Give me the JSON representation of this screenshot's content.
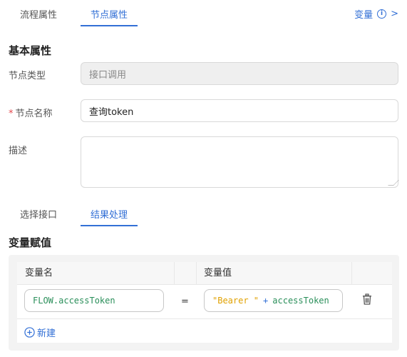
{
  "tabs": {
    "process_properties": "流程属性",
    "node_properties": "节点属性"
  },
  "header": {
    "variables_link": "变量",
    "info_icon": "info-icon",
    "chevron": ">"
  },
  "basic": {
    "title": "基本属性",
    "node_type_label": "节点类型",
    "node_type_value": "接口调用",
    "node_name_label": "节点名称",
    "node_name_value": "查询token",
    "description_label": "描述",
    "description_value": ""
  },
  "subtabs": {
    "select_interface": "选择接口",
    "result_handling": "结果处理"
  },
  "assignment": {
    "title": "变量赋值",
    "columns": [
      "变量名",
      "变量值"
    ],
    "rows": [
      {
        "name": "FLOW.accessToken",
        "op": "=",
        "value_string": "\"Bearer \"",
        "value_op": "+",
        "value_var": "accessToken"
      }
    ],
    "add_label": "新建"
  },
  "colors": {
    "accent": "#3370d6",
    "required": "#e5484d",
    "string": "#e0a100",
    "variable": "#2a8f5a"
  }
}
